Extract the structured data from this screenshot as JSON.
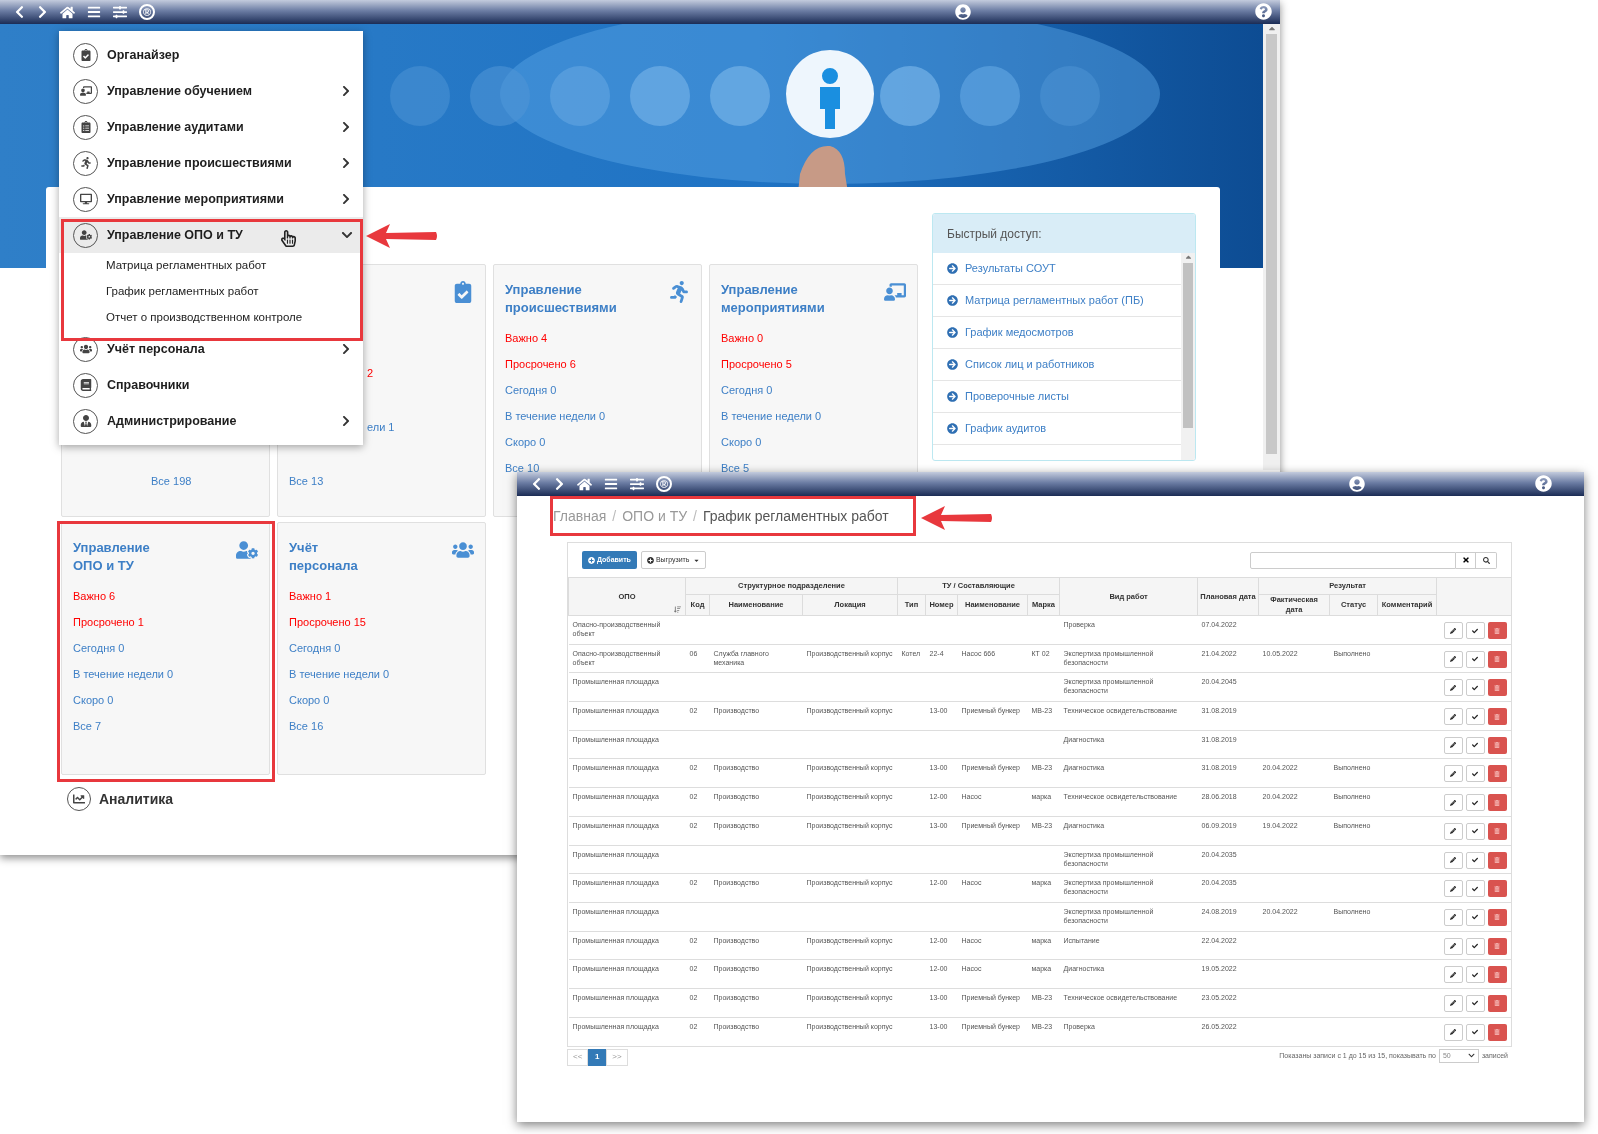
{
  "main_window": {
    "toolbar": {
      "logo": "®"
    },
    "menu": {
      "items": [
        {
          "label": "Органайзер",
          "expandable": false,
          "expanded": false
        },
        {
          "label": "Управление обучением",
          "expandable": true,
          "expanded": false
        },
        {
          "label": "Управление аудитами",
          "expandable": true,
          "expanded": false
        },
        {
          "label": "Управление происшествиями",
          "expandable": true,
          "expanded": false
        },
        {
          "label": "Управление мероприятиями",
          "expandable": true,
          "expanded": false
        },
        {
          "label": "Управление ОПО и ТУ",
          "expandable": true,
          "expanded": true,
          "children": [
            {
              "label": "Матрица регламентных работ"
            },
            {
              "label": "График регламентных работ"
            },
            {
              "label": "Отчет о производственном контроле"
            }
          ]
        },
        {
          "label": "Учёт персонала",
          "expandable": true,
          "expanded": false
        },
        {
          "label": "Справочники",
          "expandable": false,
          "expanded": false
        },
        {
          "label": "Администрирование",
          "expandable": true,
          "expanded": false
        }
      ]
    },
    "cards_row_1": [
      {
        "covered": true,
        "stats": [
          {
            "text": "Все 198",
            "urgent": false
          }
        ]
      },
      {
        "covered": true,
        "stats": [
          {
            "text": "2",
            "urgent": true
          },
          {
            "text": "ели 1",
            "urgent": false
          },
          {
            "text": "Все 13",
            "urgent": false,
            "unshifted": true
          }
        ]
      },
      {
        "covered": false,
        "title": "Управление\nпроисшествиями",
        "stats": [
          {
            "text": "Важно 4",
            "urgent": true
          },
          {
            "text": "Просрочено 6",
            "urgent": true
          },
          {
            "text": "Сегодня 0",
            "urgent": false
          },
          {
            "text": "В течение недели 0",
            "urgent": false
          },
          {
            "text": "Скоро 0",
            "urgent": false
          },
          {
            "text": "Все 10",
            "urgent": false
          }
        ]
      },
      {
        "covered": false,
        "title": "Управление\nмероприятиями",
        "stats": [
          {
            "text": "Важно 0",
            "urgent": true
          },
          {
            "text": "Просрочено 5",
            "urgent": true
          },
          {
            "text": "Сегодня 0",
            "urgent": false
          },
          {
            "text": "В течение недели 0",
            "urgent": false
          },
          {
            "text": "Скоро 0",
            "urgent": false
          },
          {
            "text": "Все 5",
            "urgent": false
          }
        ]
      }
    ],
    "quick_access": {
      "title": "Быстрый доступ:",
      "items": [
        {
          "label": "Результаты СОУТ"
        },
        {
          "label": "Матрица регламентных работ (ПБ)"
        },
        {
          "label": "График медосмотров"
        },
        {
          "label": "Список лиц и работников"
        },
        {
          "label": "Проверочные листы"
        },
        {
          "label": "График аудитов"
        }
      ]
    },
    "cards_row_2": [
      {
        "covered": false,
        "title": "Управление\nОПО и ТУ",
        "stats": [
          {
            "text": "Важно 6",
            "urgent": true
          },
          {
            "text": "Просрочено 1",
            "urgent": true
          },
          {
            "text": "Сегодня 0",
            "urgent": false
          },
          {
            "text": "В течение недели 0",
            "urgent": false
          },
          {
            "text": "Скоро 0",
            "urgent": false
          },
          {
            "text": "Все 7",
            "urgent": false
          }
        ]
      },
      {
        "covered": false,
        "title": "Учёт\nперсонала",
        "stats": [
          {
            "text": "Важно 1",
            "urgent": true
          },
          {
            "text": "Просрочено 15",
            "urgent": true
          },
          {
            "text": "Сегодня 0",
            "urgent": false
          },
          {
            "text": "В течение недели 0",
            "urgent": false
          },
          {
            "text": "Скоро 0",
            "urgent": false
          },
          {
            "text": "Все 16",
            "urgent": false
          }
        ]
      }
    ],
    "analytics": {
      "title": "Аналитика"
    }
  },
  "schedule_window": {
    "toolbar": {
      "logo": "®"
    },
    "breadcrumb": {
      "separator": "/",
      "items": [
        {
          "label": "Главная",
          "selected": false
        },
        {
          "label": "ОПО и ТУ",
          "selected": false
        },
        {
          "label": "График регламентных работ",
          "selected": true
        }
      ]
    },
    "buttons": {
      "add": "Добавить",
      "export": "Выгрузить"
    },
    "table": {
      "groups": {
        "opo": "ОПО",
        "unit": "Структурное подразделение",
        "component": "ТУ / Составляющие",
        "work_type": "Вид работ",
        "planned_date": "Плановая дата",
        "result": "Результат"
      },
      "columns": {
        "code": "Код",
        "unit_name": "Наименование",
        "location": "Локация",
        "type": "Тип",
        "number": "Номер",
        "component_name": "Наименование",
        "brand": "Марка",
        "actual_date": "Фактическая дата",
        "status": "Статус",
        "comment": "Комментарий"
      },
      "rows": [
        {
          "opo": "Опасно-производственный объект",
          "work_type": "Проверка",
          "planned_date": "07.04.2022"
        },
        {
          "opo": "Опасно-производственный объект",
          "code": "06",
          "unit_name": "Служба главного механика",
          "location": "Производственный корпус",
          "type": "Котел",
          "number": "22-4",
          "component_name": "Насос 666",
          "brand": "КТ 02",
          "work_type": "Экспертиза промышленной безопасности",
          "planned_date": "21.04.2022",
          "actual_date": "10.05.2022",
          "status": "Выполнено"
        },
        {
          "opo": "Промышленная площадка",
          "work_type": "Экспертиза промышленной безопасности",
          "planned_date": "20.04.2045"
        },
        {
          "opo": "Промышленная площадка",
          "code": "02",
          "unit_name": "Производство",
          "location": "Производственный корпус",
          "number": "13-00",
          "component_name": "Приемный бункер",
          "brand": "МВ-23",
          "work_type": "Техническое освидетельствование",
          "planned_date": "31.08.2019"
        },
        {
          "opo": "Промышленная площадка",
          "work_type": "Диагностика",
          "planned_date": "31.08.2019"
        },
        {
          "opo": "Промышленная площадка",
          "code": "02",
          "unit_name": "Производство",
          "location": "Производственный корпус",
          "number": "13-00",
          "component_name": "Приемный бункер",
          "brand": "МВ-23",
          "work_type": "Диагностика",
          "planned_date": "31.08.2019",
          "actual_date": "20.04.2022",
          "status": "Выполнено"
        },
        {
          "opo": "Промышленная площадка",
          "code": "02",
          "unit_name": "Производство",
          "location": "Производственный корпус",
          "number": "12-00",
          "component_name": "Насос",
          "brand": "марка",
          "work_type": "Техническое освидетельствование",
          "planned_date": "28.06.2018",
          "actual_date": "20.04.2022",
          "status": "Выполнено"
        },
        {
          "opo": "Промышленная площадка",
          "code": "02",
          "unit_name": "Производство",
          "location": "Производственный корпус",
          "number": "13-00",
          "component_name": "Приемный бункер",
          "brand": "МВ-23",
          "work_type": "Диагностика",
          "planned_date": "06.09.2019",
          "actual_date": "19.04.2022",
          "status": "Выполнено"
        },
        {
          "opo": "Промышленная площадка",
          "work_type": "Экспертиза промышленной безопасности",
          "planned_date": "20.04.2035"
        },
        {
          "opo": "Промышленная площадка",
          "code": "02",
          "unit_name": "Производство",
          "location": "Производственный корпус",
          "number": "12-00",
          "component_name": "Насос",
          "brand": "марка",
          "work_type": "Экспертиза промышленной безопасности",
          "planned_date": "20.04.2035"
        },
        {
          "opo": "Промышленная площадка",
          "work_type": "Экспертиза промышленной безопасности",
          "planned_date": "24.08.2019",
          "actual_date": "20.04.2022",
          "status": "Выполнено"
        },
        {
          "opo": "Промышленная площадка",
          "code": "02",
          "unit_name": "Производство",
          "location": "Производственный корпус",
          "number": "12-00",
          "component_name": "Насос",
          "brand": "марка",
          "work_type": "Испытание",
          "planned_date": "22.04.2022"
        },
        {
          "opo": "Промышленная площадка",
          "code": "02",
          "unit_name": "Производство",
          "location": "Производственный корпус",
          "number": "12-00",
          "component_name": "Насос",
          "brand": "марка",
          "work_type": "Диагностика",
          "planned_date": "19.05.2022"
        },
        {
          "opo": "Промышленная площадка",
          "code": "02",
          "unit_name": "Производство",
          "location": "Производственный корпус",
          "number": "13-00",
          "component_name": "Приемный бункер",
          "brand": "МВ-23",
          "work_type": "Техническое освидетельствование",
          "planned_date": "23.05.2022"
        },
        {
          "opo": "Промышленная площадка",
          "code": "02",
          "unit_name": "Производство",
          "location": "Производственный корпус",
          "number": "13-00",
          "component_name": "Приемный бункер",
          "brand": "МВ-23",
          "work_type": "Проверка",
          "planned_date": "26.05.2022"
        }
      ]
    },
    "pagination": [
      {
        "label": "<<",
        "selected": false
      },
      {
        "label": "1",
        "selected": true
      },
      {
        "label": ">>",
        "selected": false
      }
    ],
    "footer": {
      "summary": "Показаны записи с 1 до 15 из 15, показывать по",
      "page_size": "50",
      "suffix": "записей"
    }
  }
}
